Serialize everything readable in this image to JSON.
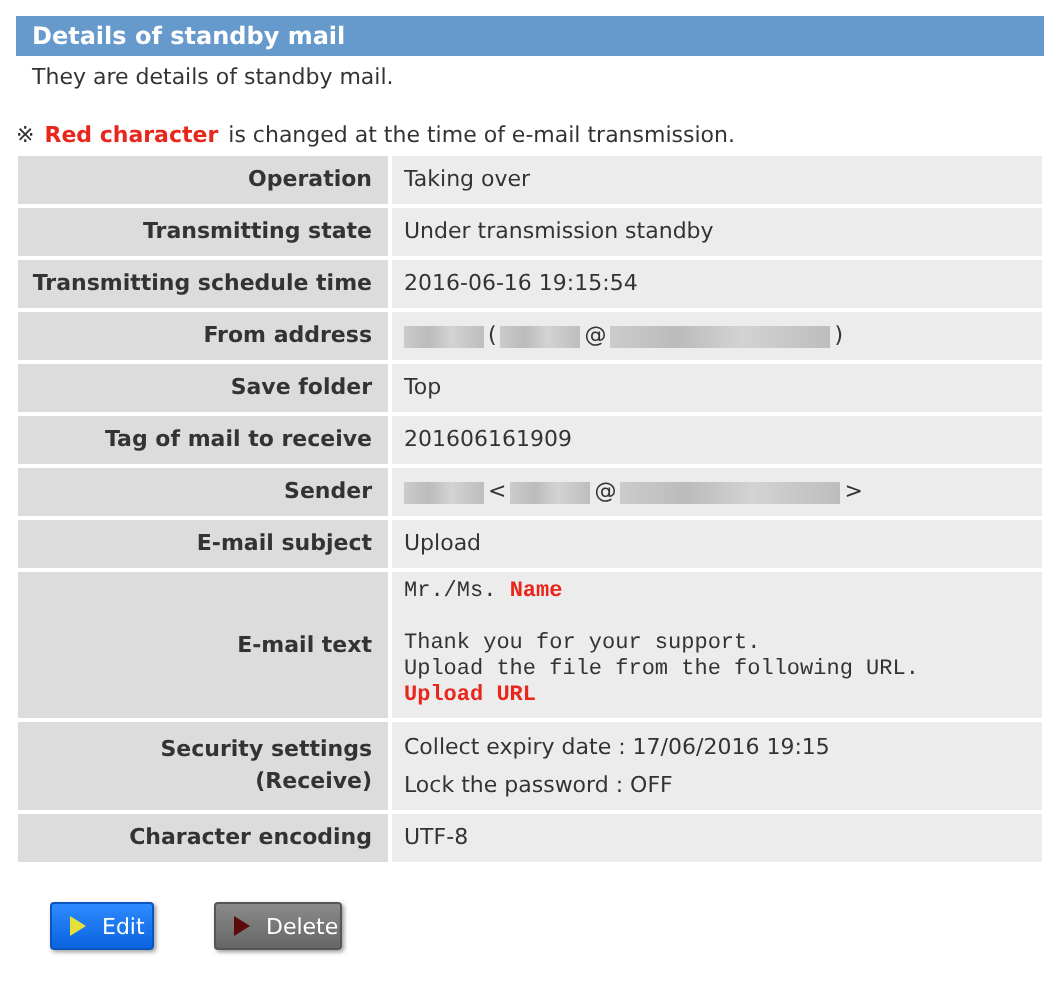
{
  "panel": {
    "title": "Details of standby mail",
    "description": "They are details of standby mail."
  },
  "notice": {
    "mark": "※",
    "highlight": "Red character",
    "text": "is changed at the time of e-mail transmission."
  },
  "rows": [
    {
      "label": "Operation",
      "kind": "text",
      "value": "Taking over"
    },
    {
      "label": "Transmitting state",
      "kind": "text",
      "value": "Under transmission standby"
    },
    {
      "label": "Transmitting schedule time",
      "kind": "text",
      "value": "2016-06-16 19:15:54"
    },
    {
      "label": "From address",
      "kind": "segments",
      "segments": [
        {
          "kind": "redacted"
        },
        {
          "kind": "text",
          "text": "("
        },
        {
          "kind": "redacted"
        },
        {
          "kind": "text",
          "text": "@"
        },
        {
          "kind": "redacted-long"
        },
        {
          "kind": "text",
          "text": ")"
        }
      ]
    },
    {
      "label": "Save folder",
      "kind": "text",
      "value": "Top"
    },
    {
      "label": "Tag of mail to receive",
      "kind": "text",
      "value": "201606161909"
    },
    {
      "label": "Sender",
      "kind": "segments",
      "segments": [
        {
          "kind": "redacted"
        },
        {
          "kind": "text",
          "text": "<"
        },
        {
          "kind": "redacted"
        },
        {
          "kind": "text",
          "text": "@"
        },
        {
          "kind": "redacted-long"
        },
        {
          "kind": "text",
          "text": ">"
        }
      ]
    },
    {
      "label": "E-mail subject",
      "kind": "text",
      "value": "Upload"
    },
    {
      "label": "E-mail text",
      "kind": "mail",
      "paragraphs": [
        [
          [
            {
              "text": "Mr./Ms. ",
              "highlight": false
            },
            {
              "text": "Name",
              "highlight": true
            }
          ]
        ],
        [
          [
            {
              "text": "Thank you for your support.",
              "highlight": false
            }
          ],
          [
            {
              "text": "Upload the file from the following URL.",
              "highlight": false
            }
          ],
          [
            {
              "text": "Upload URL",
              "highlight": true
            }
          ]
        ]
      ]
    },
    {
      "label_lines": [
        "Security settings",
        "(Receive)"
      ],
      "kind": "lines",
      "lines": [
        "Collect expiry date : 17/06/2016 19:15",
        "Lock the password : OFF"
      ]
    },
    {
      "label": "Character encoding",
      "kind": "text",
      "value": "UTF-8"
    }
  ],
  "buttons": [
    {
      "label": "Edit",
      "kind": "primary"
    },
    {
      "label": "Delete",
      "kind": "danger"
    }
  ]
}
